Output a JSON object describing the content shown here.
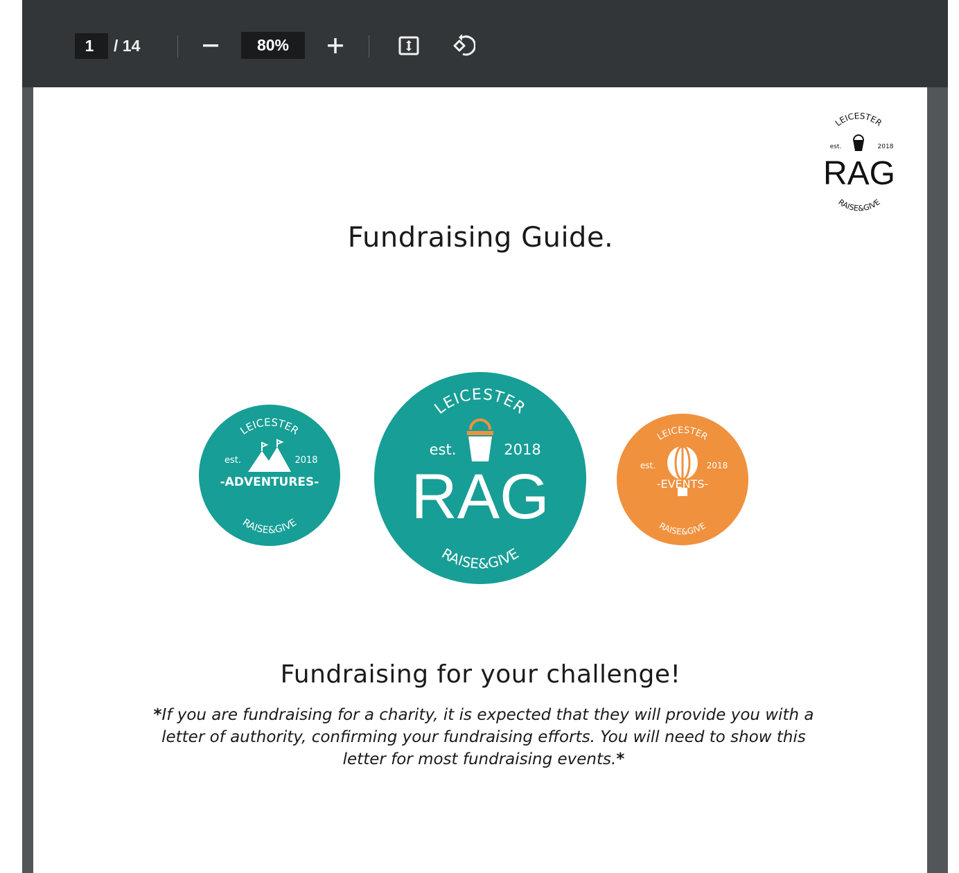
{
  "toolbar": {
    "current_page": "1",
    "page_total": "/ 14",
    "zoom": "80%",
    "zoom_out_icon": "minus-icon",
    "zoom_in_icon": "plus-icon",
    "fit_icon": "fit-to-page-icon",
    "rotate_icon": "rotate-counterclockwise-icon"
  },
  "document": {
    "title": "Fundraising Guide.",
    "subtitle": "Fundraising for your challenge!",
    "note_star_open": "*",
    "note_text": "If you are fundraising for a charity, it is expected that they will provide you with a letter of authority, confirming your fundraising efforts. You will need to show this letter for most fundraising events.",
    "note_star_close": "*"
  },
  "logos": {
    "corner": {
      "top": "LEICESTER",
      "left": "est.",
      "right": "2018",
      "main": "RAG",
      "bottom": "RAISE&GIVE"
    },
    "adventures": {
      "top": "LEICESTER",
      "left": "est.",
      "right": "2018",
      "main": "-ADVENTURES-",
      "bottom": "RAISE&GIVE",
      "color": "#179e96"
    },
    "rag": {
      "top": "LEICESTER",
      "left": "est.",
      "right": "2018",
      "main": "RAG",
      "bottom": "RAISE&GIVE",
      "color": "#179e96"
    },
    "events": {
      "top": "LEICESTER",
      "left": "est.",
      "right": "2018",
      "main": "-EVENTS-",
      "bottom": "RAISE&GIVE",
      "color": "#f0913e"
    }
  },
  "colors": {
    "teal": "#179e96",
    "orange": "#f0913e",
    "toolbar": "#323639",
    "viewer_bg": "#525659"
  }
}
